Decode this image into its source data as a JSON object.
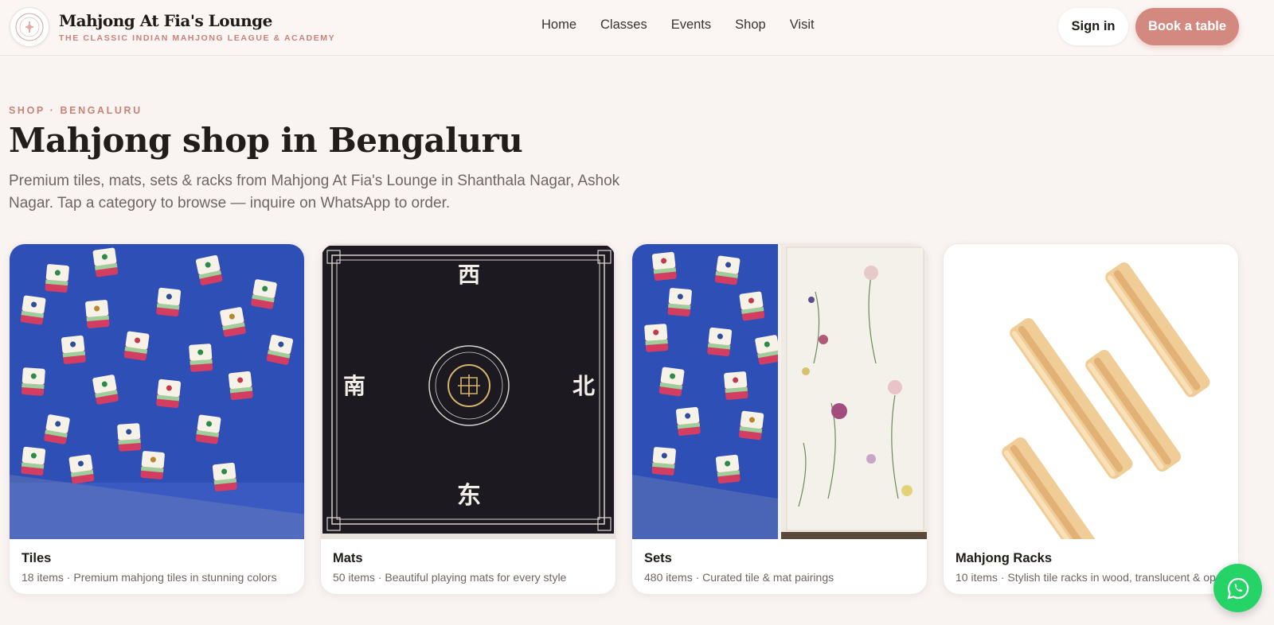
{
  "brand": {
    "name": "Mahjong At Fia's Lounge",
    "tagline": "THE CLASSIC INDIAN MAHJONG LEAGUE & ACADEMY"
  },
  "nav": {
    "items": [
      "Home",
      "Classes",
      "Events",
      "Shop",
      "Visit"
    ]
  },
  "header_actions": {
    "signin_label": "Sign in",
    "book_label": "Book a table"
  },
  "hero": {
    "eyebrow": "SHOP · BENGALURU",
    "title": "Mahjong shop in Bengaluru",
    "subtitle": "Premium tiles, mats, sets & racks from Mahjong At Fia's Lounge in Shanthala Nagar, Ashok Nagar. Tap a category to browse — inquire on WhatsApp to order."
  },
  "categories": [
    {
      "title": "Tiles",
      "meta": "18 items · Premium mahjong tiles in stunning colors",
      "image": "tiles-photo"
    },
    {
      "title": "Mats",
      "meta": "50 items · Beautiful playing mats for every style",
      "image": "mat-photo"
    },
    {
      "title": "Sets",
      "meta": "480 items · Curated tile & mat pairings",
      "image": "sets-photo"
    },
    {
      "title": "Mahjong Racks",
      "meta": "10 items · Stylish tile racks in wood, translucent & op",
      "image": "racks-photo"
    }
  ],
  "mat_glyphs": {
    "top": "西",
    "left": "南",
    "right": "北",
    "bottom": "东"
  },
  "colors": {
    "accent": "#d3897f",
    "background": "#f9f4f2",
    "whatsapp": "#25d366",
    "tile_blue": "#2e4fb5",
    "tile_pink": "#d33d62"
  },
  "floating": {
    "icon": "whatsapp-icon"
  }
}
